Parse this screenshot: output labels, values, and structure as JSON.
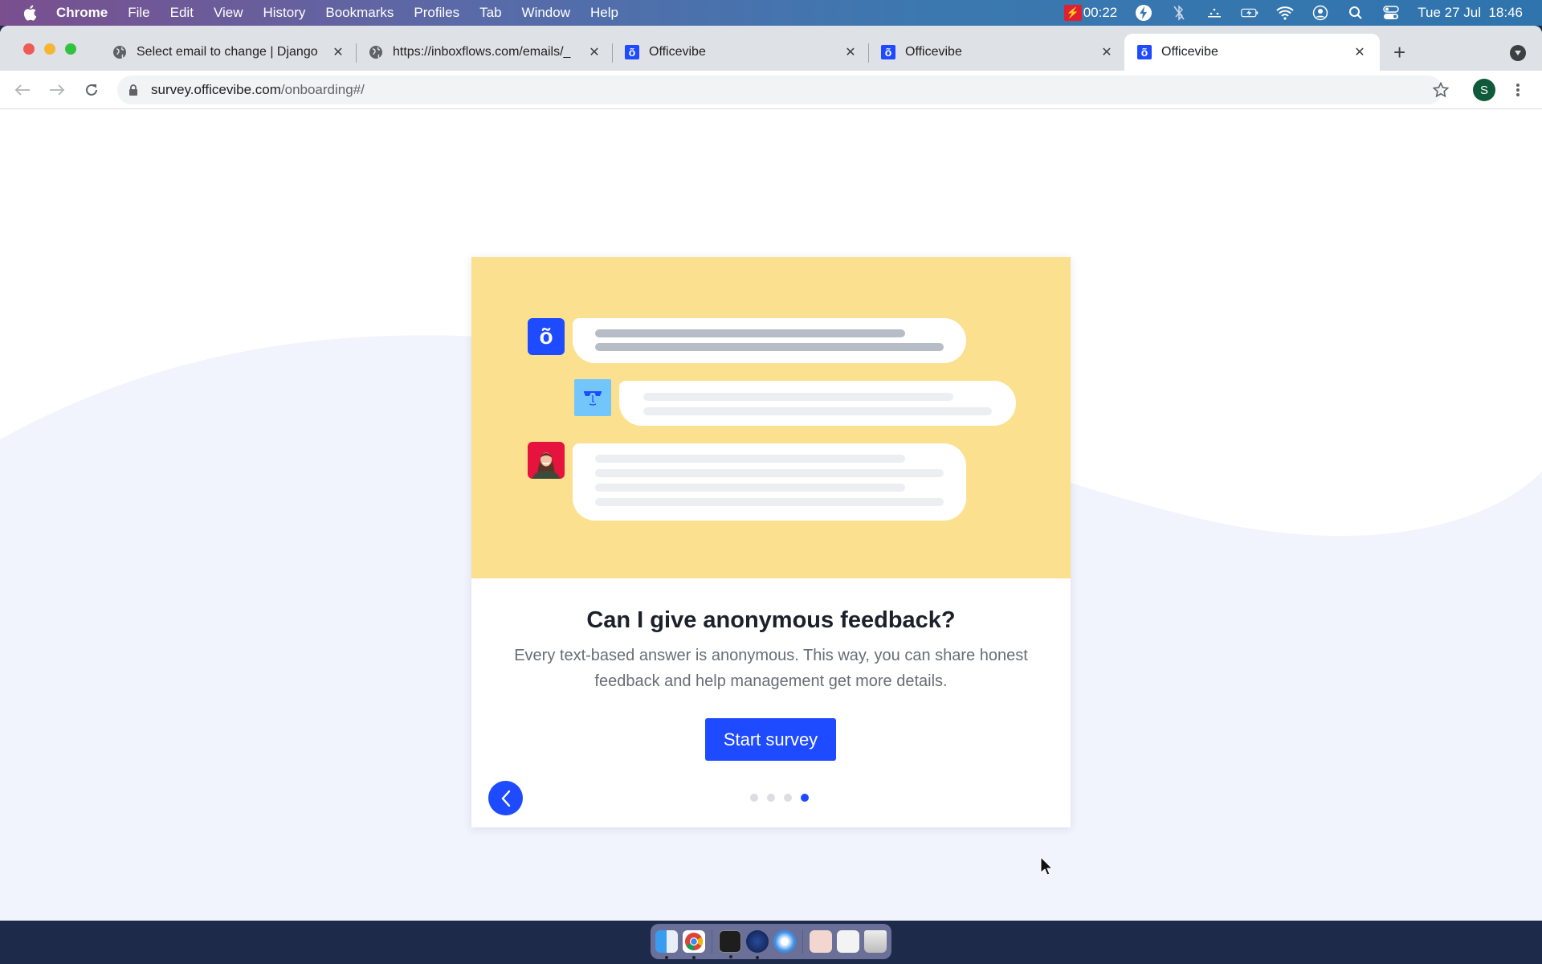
{
  "menubar": {
    "app_name": "Chrome",
    "items": [
      "File",
      "Edit",
      "View",
      "History",
      "Bookmarks",
      "Profiles",
      "Tab",
      "Window",
      "Help"
    ],
    "recording_timer": "00:22",
    "datetime": "Tue 27 Jul  18:46",
    "tray_icons": [
      "lightning-icon",
      "bluetooth-off-icon",
      "dots-icon",
      "battery-charging-icon",
      "wifi-icon",
      "user-icon",
      "search-icon",
      "control-center-icon"
    ]
  },
  "browser": {
    "tabs": [
      {
        "title": "Select email to change | Django",
        "favicon": "globe-icon",
        "active": false
      },
      {
        "title": "https://inboxflows.com/emails/_",
        "favicon": "globe-icon",
        "active": false
      },
      {
        "title": "Officevibe",
        "favicon": "officevibe-icon",
        "active": false
      },
      {
        "title": "Officevibe",
        "favicon": "officevibe-icon",
        "active": false
      },
      {
        "title": "Officevibe",
        "favicon": "officevibe-icon",
        "active": true
      }
    ],
    "close_glyph": "✕",
    "new_tab_glyph": "+",
    "url_domain": "survey.officevibe.com",
    "url_path": "/onboarding#/",
    "profile_initial": "S"
  },
  "card": {
    "illustration": {
      "logo_glyph": "õ"
    },
    "title": "Can I give anonymous feedback?",
    "description": "Every text-based answer is anonymous. This way, you can share honest feedback and help management get more details.",
    "start_button": "Start survey",
    "pagination": {
      "total": 4,
      "current": 4
    }
  },
  "colors": {
    "brand_blue": "#1e4bff",
    "illustration_yellow": "#fbe18f",
    "background_wave": "#f1f3fd"
  },
  "dock": {
    "apps": [
      "finder",
      "chrome",
      "terminal",
      "bolt-app",
      "safari",
      "folder-document",
      "screenshot-thumbnail",
      "trash"
    ]
  }
}
